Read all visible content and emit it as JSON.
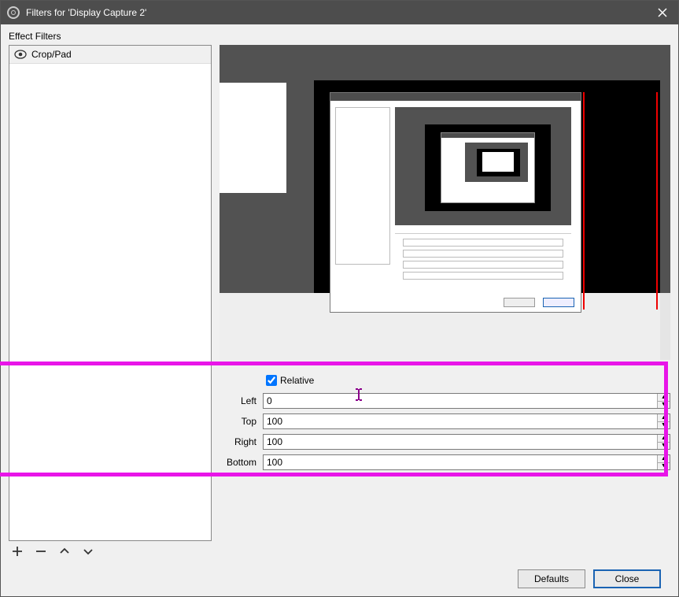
{
  "title": "Filters for 'Display Capture 2'",
  "section_label": "Effect Filters",
  "filters": {
    "items": [
      {
        "label": "Crop/Pad",
        "visible": true
      }
    ]
  },
  "toolbar": {
    "add": "+",
    "remove": "−",
    "up": "▴",
    "down": "▾"
  },
  "form": {
    "relative_label": "Relative",
    "relative_checked": true,
    "left_label": "Left",
    "left_value": "0",
    "top_label": "Top",
    "top_value": "100",
    "right_label": "Right",
    "right_value": "100",
    "bottom_label": "Bottom",
    "bottom_value": "100"
  },
  "footer": {
    "defaults": "Defaults",
    "close": "Close"
  },
  "colors": {
    "highlight": "#e815e8",
    "titlebar": "#4d4d4d",
    "preview_bg": "#525252"
  }
}
